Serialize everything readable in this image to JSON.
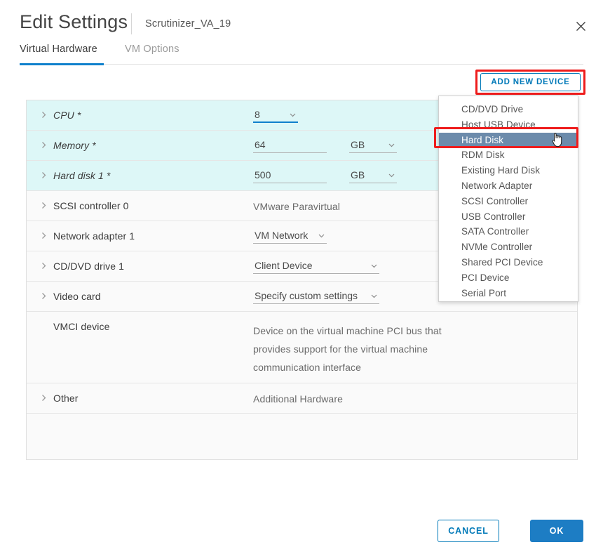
{
  "header": {
    "title": "Edit Settings",
    "subtitle": "Scrutinizer_VA_19",
    "close_icon": "close-icon"
  },
  "tabs": [
    {
      "label": "Virtual Hardware",
      "active": true
    },
    {
      "label": "VM Options",
      "active": false
    }
  ],
  "toolbar": {
    "add_new_device_label": "ADD NEW DEVICE",
    "annotation_color": "#ee1c1c"
  },
  "hardware": {
    "rows": [
      {
        "label": "CPU *",
        "modified": true,
        "expandable": true,
        "widget": "select",
        "value": "8",
        "focused": true,
        "unit": null
      },
      {
        "label": "Memory *",
        "modified": true,
        "expandable": true,
        "widget": "input-unit",
        "value": "64",
        "focused": false,
        "unit": "GB"
      },
      {
        "label": "Hard disk 1 *",
        "modified": true,
        "expandable": true,
        "widget": "input-unit",
        "value": "500",
        "focused": false,
        "unit": "GB"
      },
      {
        "label": "SCSI controller 0",
        "modified": false,
        "expandable": true,
        "widget": "text",
        "value": "VMware Paravirtual",
        "unit": null
      },
      {
        "label": "Network adapter 1",
        "modified": false,
        "expandable": true,
        "widget": "select",
        "value": "VM Network",
        "unit": null
      },
      {
        "label": "CD/DVD drive 1",
        "modified": false,
        "expandable": true,
        "widget": "select",
        "value": "Client Device",
        "unit": null
      },
      {
        "label": "Video card",
        "modified": false,
        "expandable": true,
        "widget": "select",
        "value": "Specify custom settings",
        "unit": null
      },
      {
        "label": "VMCI device",
        "modified": false,
        "expandable": false,
        "widget": "description",
        "value": "Device on the virtual machine PCI bus that provides support for the virtual machine communication interface",
        "unit": null
      },
      {
        "label": "Other",
        "modified": false,
        "expandable": true,
        "widget": "text",
        "value": "Additional Hardware",
        "unit": null
      }
    ]
  },
  "add_device_menu": {
    "items": [
      {
        "label": "CD/DVD Drive",
        "selected": false
      },
      {
        "label": "Host USB Device",
        "selected": false
      },
      {
        "label": "Hard Disk",
        "selected": true
      },
      {
        "label": "RDM Disk",
        "selected": false
      },
      {
        "label": "Existing Hard Disk",
        "selected": false
      },
      {
        "label": "Network Adapter",
        "selected": false
      },
      {
        "label": "SCSI Controller",
        "selected": false
      },
      {
        "label": "USB Controller",
        "selected": false
      },
      {
        "label": "SATA Controller",
        "selected": false
      },
      {
        "label": "NVMe Controller",
        "selected": false
      },
      {
        "label": "Shared PCI Device",
        "selected": false
      },
      {
        "label": "PCI Device",
        "selected": false
      },
      {
        "label": "Serial Port",
        "selected": false
      }
    ],
    "highlight_color": "#6c8bab",
    "cursor_icon": "pointer-hand-cursor"
  },
  "footer": {
    "cancel_label": "CANCEL",
    "ok_label": "OK",
    "accent_color": "#0079b8"
  }
}
